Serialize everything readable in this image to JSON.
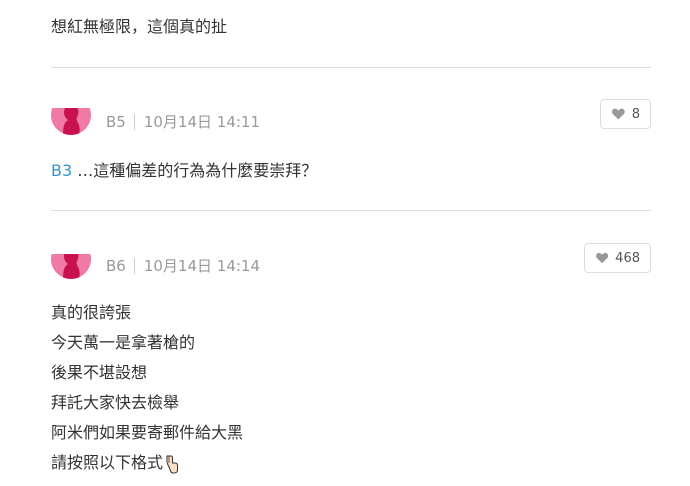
{
  "comments": [
    {
      "lines": [
        "想紅無極限，這個真的扯"
      ]
    },
    {
      "floor": "B5",
      "timestamp": "10月14日 14:11",
      "likes": "8",
      "reply_ref": "B3",
      "reply_text": " …這種偏差的行為為什麼要崇拜？"
    },
    {
      "floor": "B6",
      "timestamp": "10月14日 14:14",
      "likes": "468",
      "lines": [
        "真的很誇張",
        "今天萬一是拿著槍的",
        "後果不堪設想",
        "拜託大家快去檢舉",
        "阿米們如果要寄郵件給大黑",
        "請按照以下格式"
      ]
    }
  ],
  "icons": {
    "like": "heart-icon",
    "avatar": "default-avatar-silhouette",
    "pointer": "backhand-index-pointing-down-icon"
  },
  "colors": {
    "avatar": "#f07aa6",
    "floor_link": "#3397cf",
    "divider": "#dddddd",
    "meta": "#999999"
  }
}
